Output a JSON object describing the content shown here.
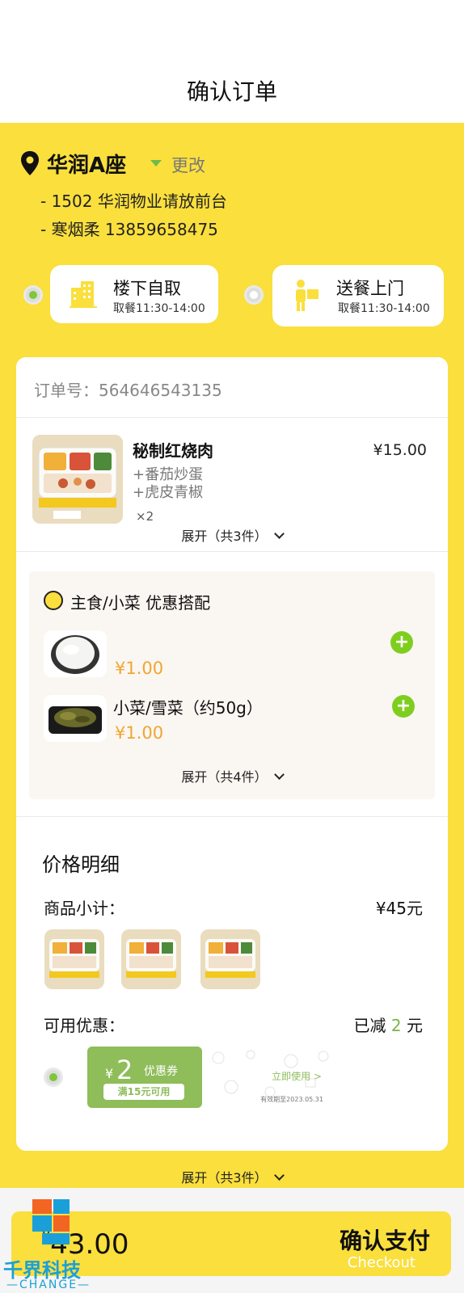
{
  "header": {
    "title": "确认订单"
  },
  "location": {
    "name": "华润A座",
    "change_label": "更改",
    "address_line1": "- 1502 华润物业请放前台",
    "address_line2": "- 寒烟柔 13859658475"
  },
  "delivery_options": [
    {
      "title": "楼下自取",
      "time": "取餐11:30-14:00",
      "selected": true,
      "icon": "building-icon"
    },
    {
      "title": "送餐上门",
      "time": "取餐11:30-14:00",
      "selected": false,
      "icon": "delivery-person-icon"
    }
  ],
  "order": {
    "number_label": "订单号：",
    "number": "564646543135",
    "item": {
      "name": "秘制红烧肉",
      "sides": [
        "+番茄炒蛋",
        "+虎皮青椒"
      ],
      "qty": "×2",
      "price": "¥15.00"
    },
    "expand_label": "展开（共3件）"
  },
  "combo": {
    "title": "主食/小菜  优惠搭配",
    "items": [
      {
        "name": "",
        "price": "¥1.00",
        "image": "rice"
      },
      {
        "name": "小菜/雪菜（约50g）",
        "price": "¥1.00",
        "image": "pickled-greens"
      }
    ],
    "expand_label": "展开（共4件）"
  },
  "price_detail": {
    "title": "价格明细",
    "subtotal_label": "商品小计：",
    "subtotal_value": "¥45元",
    "discount_label": "可用优惠：",
    "discount_prefix": "已减",
    "discount_amount": "2",
    "discount_suffix": "元"
  },
  "coupon": {
    "yen": "¥",
    "amount": "2",
    "type": "优惠券",
    "condition": "满15元可用",
    "use_label": "立即使用 >",
    "valid": "有效期至2023.05.31"
  },
  "bottom_expand_label": "展开（共3件）",
  "checkout": {
    "total_yen": "¥",
    "total": "43.00",
    "pay_label": "确认支付",
    "pay_sub": "Checkout"
  },
  "watermark": {
    "text": "千界科技",
    "sub": "—CHANGE—"
  },
  "colors": {
    "brand_yellow": "#fadf3d",
    "accent_green": "#7fce1f",
    "price_orange": "#f0a532"
  }
}
